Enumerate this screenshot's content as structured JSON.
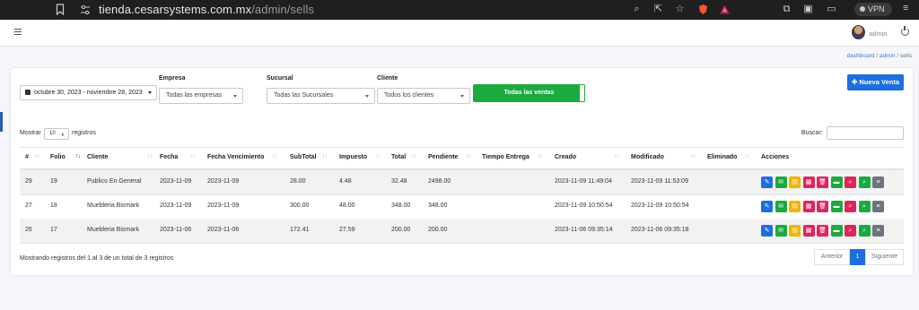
{
  "browser": {
    "url_domain": "tienda.cesarsystems.com.mx",
    "url_path": "/admin/sells",
    "vpn_label": "VPN"
  },
  "header": {
    "user_name": "admin"
  },
  "breadcrumb": {
    "items": [
      "dashboard",
      "admin",
      "sells"
    ],
    "separator": "/"
  },
  "filters": {
    "date_range": "octubre 30, 2023 - noviembre 28, 2023",
    "empresa_label": "Empresa",
    "empresa_value": "Todas las empresas",
    "sucursal_label": "Sucursal",
    "sucursal_value": "Todas las Sucursales",
    "cliente_label": "Cliente",
    "cliente_value": "Todos los clientes",
    "toggle_label": "Todas las ventas"
  },
  "new_button": "Nueva Venta",
  "length": {
    "prefix": "Mostrar",
    "value": "10",
    "suffix": "registros"
  },
  "search_label": "Buscar:",
  "table": {
    "headers": [
      "#",
      "Folio",
      "Cliente",
      "Fecha",
      "Fecha Vencimiento",
      "SubTotal",
      "Impuesto",
      "Total",
      "Pendiente",
      "Tiempo Entrega",
      "Creado",
      "Modificado",
      "Eliminado",
      "Acciones"
    ],
    "rows": [
      [
        "29",
        "19",
        "Publico En General",
        "2023-11-09",
        "2023-11-09",
        "28.00",
        "4.48",
        "32.48",
        "2498.00",
        "",
        "2023-11-09 11:49:04",
        "2023-11-09 11:53:09",
        ""
      ],
      [
        "27",
        "18",
        "Muebleria Bismark",
        "2023-11-09",
        "2023-11-09",
        "300.00",
        "48.00",
        "348.00",
        "348.00",
        "",
        "2023-11-09 10:50:54",
        "2023-11-09 10:50:54",
        ""
      ],
      [
        "26",
        "17",
        "Muebleria Bismark",
        "2023-11-06",
        "2023-11-06",
        "172.41",
        "27.59",
        "200.00",
        "200.00",
        "",
        "2023-11-06 09:35:14",
        "2023-11-06 09:35:18",
        ""
      ]
    ],
    "actions": [
      {
        "name": "edit",
        "color": "#1d6fe0",
        "glyph": "✎"
      },
      {
        "name": "email",
        "color": "#1aaa3e",
        "glyph": "✉"
      },
      {
        "name": "pdf",
        "color": "#f5b400",
        "glyph": "▤"
      },
      {
        "name": "grid",
        "color": "#e0245e",
        "glyph": "▦"
      },
      {
        "name": "delete",
        "color": "#e0245e",
        "glyph": "🗑"
      },
      {
        "name": "money",
        "color": "#1aaa3e",
        "glyph": "▬"
      },
      {
        "name": "search-pink",
        "color": "#e0245e",
        "glyph": "⌕"
      },
      {
        "name": "search-green",
        "color": "#1aaa3e",
        "glyph": "⌕"
      },
      {
        "name": "list",
        "color": "#6c757d",
        "glyph": "≡"
      }
    ]
  },
  "footer": {
    "info": "Mostrando registros del 1 al 3 de un total de 3 registros",
    "prev": "Anterior",
    "page": "1",
    "next": "Siguiente"
  }
}
